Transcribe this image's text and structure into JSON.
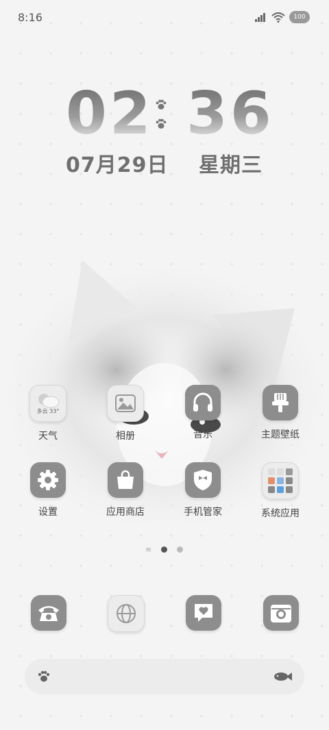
{
  "status_bar": {
    "time": "8:16",
    "battery": "100"
  },
  "clock": {
    "hours": "02",
    "minutes": "36",
    "date": "07月29日",
    "weekday": "星期三"
  },
  "apps": [
    {
      "label": "天气",
      "weather_text": "多云 33°"
    },
    {
      "label": "相册"
    },
    {
      "label": "音乐"
    },
    {
      "label": "主题壁纸"
    },
    {
      "label": "设置"
    },
    {
      "label": "应用商店"
    },
    {
      "label": "手机管家"
    },
    {
      "label": "系统应用"
    }
  ],
  "colors": {
    "icon_gray": "#8d8d8d",
    "background": "#f4f4f4",
    "text": "#444444",
    "accent": "#5aa0e0"
  }
}
